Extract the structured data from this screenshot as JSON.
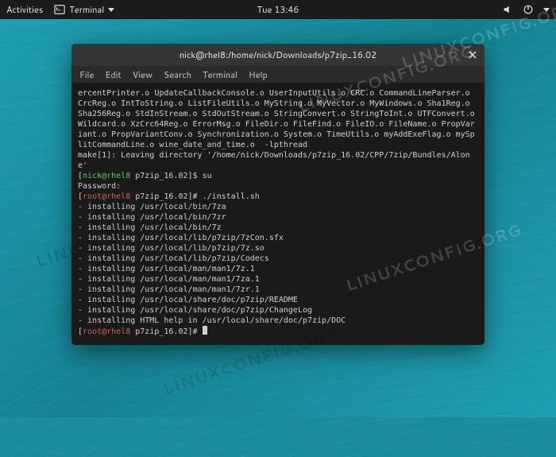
{
  "topbar": {
    "activities": "Activities",
    "app_label": "Terminal",
    "clock": "Tue 13:46"
  },
  "window": {
    "title": "nick@rhel8:/home/nick/Downloads/p7zip_16.02"
  },
  "menubar": {
    "items": [
      "File",
      "Edit",
      "View",
      "Search",
      "Terminal",
      "Help"
    ]
  },
  "term": {
    "compile_tail": "ercentPrinter.o UpdateCallbackConsole.o UserInputUtils.o CRC.o CommandLineParser.o CrcReg.o IntToString.o ListFileUtils.o MyString.o MyVector.o MyWindows.o Sha1Reg.o Sha256Reg.o StdInStream.o StdOutStream.o StringConvert.o StringToInt.o UTFConvert.o Wildcard.o XzCrc64Reg.o ErrorMsg.o FileDir.o FileFind.o FileIO.o FileName.o PropVariant.o PropVariantConv.o Synchronization.o System.o TimeUtils.o myAddExeFlag.o mySplitCommandLine.o wine_date_and_time.o  -lpthread",
    "make_leave": "make[1]: Leaving directory '/home/nick/Downloads/p7zip_16.02/CPP/7zip/Bundles/Alone'",
    "prompt_user_open": "[",
    "prompt_user_name": "nick@rhel8",
    "prompt_user_path": " p7zip_16.02",
    "prompt_user_close": "]$ ",
    "cmd_su": "su",
    "password_label": "Password:",
    "prompt_root_open": "[",
    "prompt_root_name": "root@rhel8",
    "prompt_root_path": " p7zip_16.02",
    "prompt_root_close": "]# ",
    "cmd_install": "./install.sh",
    "install_lines": [
      "- installing /usr/local/bin/7za",
      "- installing /usr/local/bin/7zr",
      "- installing /usr/local/bin/7z",
      "- installing /usr/local/lib/p7zip/7zCon.sfx",
      "- installing /usr/local/lib/p7zip/7z.so",
      "- installing /usr/local/lib/p7zip/Codecs",
      "- installing /usr/local/man/man1/7z.1",
      "- installing /usr/local/man/man1/7za.1",
      "- installing /usr/local/man/man1/7zr.1",
      "- installing /usr/local/share/doc/p7zip/README",
      "- installing /usr/local/share/doc/p7zip/ChangeLog",
      "- installing HTML help in /usr/local/share/doc/p7zip/DOC"
    ]
  },
  "watermark": "LINUXCONFIG.ORG"
}
